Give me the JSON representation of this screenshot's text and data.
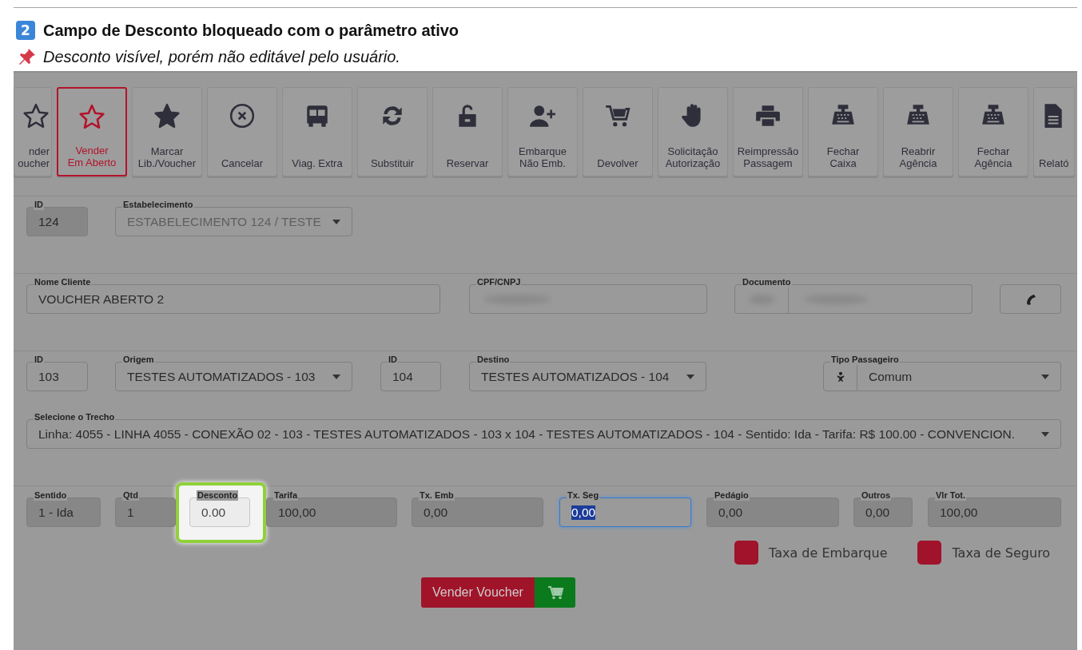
{
  "heading": {
    "step": "2",
    "title": "Campo de Desconto bloqueado com o parâmetro ativo"
  },
  "note": "Desconto visível, porém não editável pelo usuário.",
  "toolbar": [
    {
      "label": "nder\noucher",
      "selected": false
    },
    {
      "label": "Vender\nEm Aberto",
      "selected": true
    },
    {
      "label": "Marcar\nLib./Voucher",
      "selected": false
    },
    {
      "label": "Cancelar",
      "selected": false
    },
    {
      "label": "Viag. Extra",
      "selected": false
    },
    {
      "label": "Substituir",
      "selected": false
    },
    {
      "label": "Reservar",
      "selected": false
    },
    {
      "label": "Embarque\nNão Emb.",
      "selected": false
    },
    {
      "label": "Devolver",
      "selected": false
    },
    {
      "label": "Solicitação\nAutorização",
      "selected": false
    },
    {
      "label": "Reimpressão\nPassagem",
      "selected": false
    },
    {
      "label": "Fechar\nCaixa",
      "selected": false
    },
    {
      "label": "Reabrir\nAgência",
      "selected": false
    },
    {
      "label": "Fechar\nAgência",
      "selected": false
    },
    {
      "label": "Relató",
      "selected": false
    }
  ],
  "sections": [
    {
      "fields": [
        {
          "kind": "input",
          "label": "ID",
          "value": "124",
          "disabled": true
        },
        {
          "kind": "select",
          "label": "Estabelecimento",
          "value": "ESTABELECIMENTO 124 / TESTE",
          "disabled": true
        }
      ]
    },
    {
      "fields": [
        {
          "kind": "input",
          "label": "Nome Cliente",
          "value": "VOUCHER ABERTO 2",
          "disabled": false
        },
        {
          "kind": "redacted",
          "label": "CPF/CNPJ"
        },
        {
          "kind": "redacted-group",
          "label": "Documento"
        },
        {
          "kind": "phone-button"
        }
      ]
    },
    {
      "fields": [
        {
          "kind": "input",
          "label": "ID",
          "value": "103",
          "disabled": false
        },
        {
          "kind": "select",
          "label": "Origem",
          "value": "TESTES AUTOMATIZADOS - 103",
          "disabled": false
        },
        {
          "kind": "input",
          "label": "ID",
          "value": "104",
          "disabled": false
        },
        {
          "kind": "select",
          "label": "Destino",
          "value": "TESTES AUTOMATIZADOS - 104",
          "disabled": false
        },
        {
          "kind": "icon-select",
          "label": "Tipo Passageiro",
          "value": "Comum",
          "disabled": false
        }
      ]
    },
    {
      "fields": [
        {
          "kind": "select",
          "label": "Selecione o Trecho",
          "value": "Linha: 4055 - LINHA 4055 - CONEXÃO 02 - 103 - TESTES AUTOMATIZADOS - 103 x 104 - TESTES AUTOMATIZADOS - 104 - Sentido: Ida - Tarifa: R$ 100.00 - CONVENCION.",
          "disabled": false
        }
      ]
    },
    {
      "fields": [
        {
          "kind": "input",
          "label": "Sentido",
          "value": "1 - Ida",
          "disabled": true
        },
        {
          "kind": "input",
          "label": "Qtd",
          "value": "1",
          "disabled": true
        },
        {
          "kind": "input",
          "label": "Desconto",
          "value": "0.00",
          "disabled": true,
          "highlighted": true
        },
        {
          "kind": "input",
          "label": "Tarifa",
          "value": "100,00",
          "disabled": true
        },
        {
          "kind": "input",
          "label": "Tx. Emb",
          "value": "0,00",
          "disabled": true
        },
        {
          "kind": "input",
          "label": "Tx. Seg",
          "value": "0,00",
          "disabled": false,
          "focused": true
        },
        {
          "kind": "input",
          "label": "Pedágio",
          "value": "0,00",
          "disabled": true
        },
        {
          "kind": "input",
          "label": "Outros",
          "value": "0,00",
          "disabled": true
        },
        {
          "kind": "input",
          "label": "Vlr Tot.",
          "value": "100,00",
          "disabled": true
        }
      ]
    }
  ],
  "options": [
    {
      "label": "Taxa de Embarque",
      "on": true
    },
    {
      "label": "Taxa de Seguro",
      "on": true
    }
  ],
  "primary_button": {
    "label": "Vender Voucher"
  }
}
